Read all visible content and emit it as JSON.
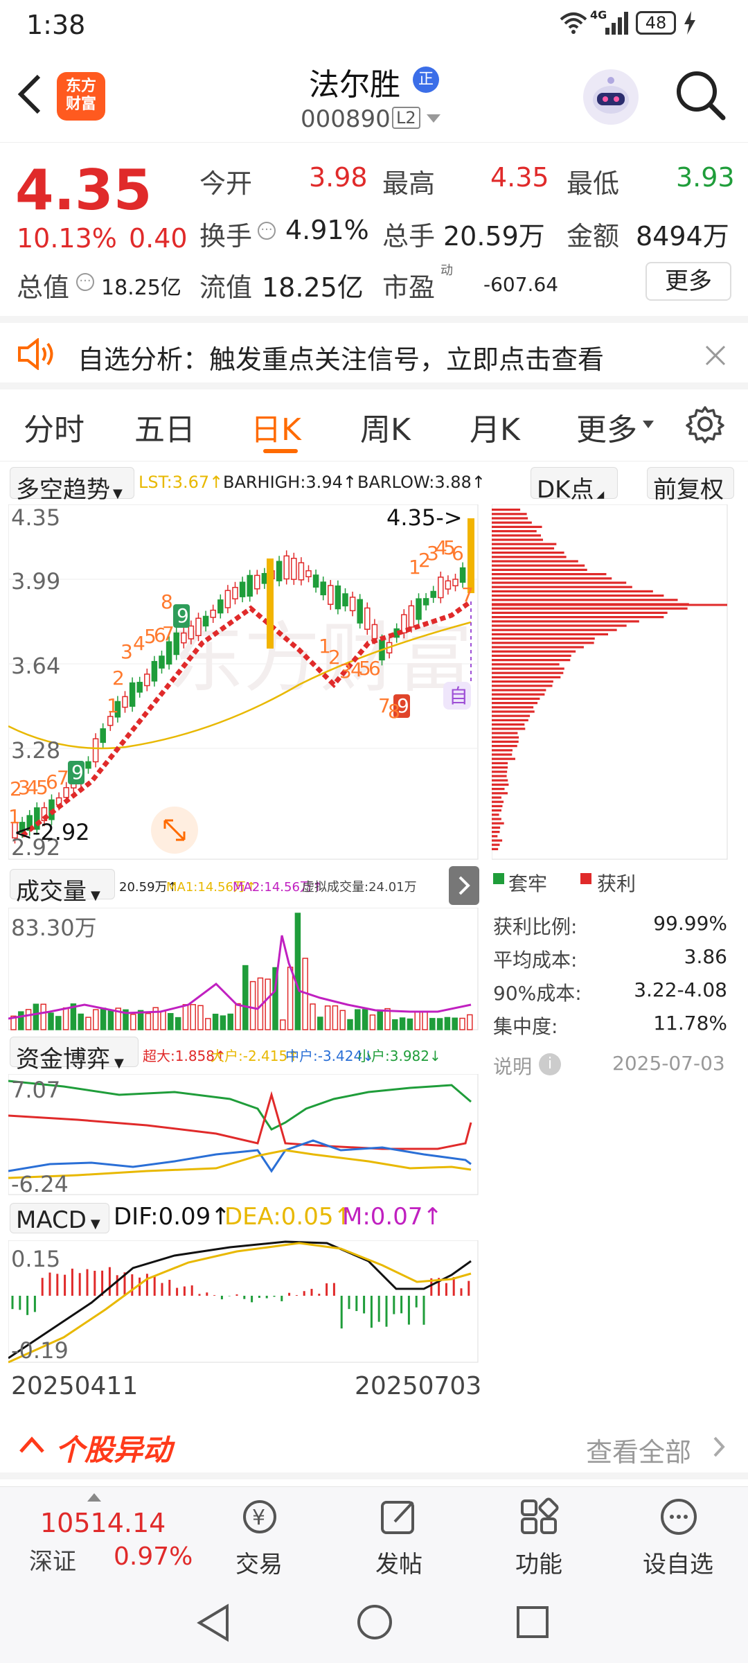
{
  "status": {
    "time": "1:38",
    "network": "4G",
    "battery": "48"
  },
  "header": {
    "logo_line1": "东方",
    "logo_line2": "财富",
    "name": "法尔胜",
    "badge": "正",
    "code": "000890",
    "level": "L2"
  },
  "quote": {
    "price": "4.35",
    "pct": "10.13%",
    "change": "0.40",
    "open_label": "今开",
    "open": "3.98",
    "high_label": "最高",
    "high": "4.35",
    "low_label": "最低",
    "low": "3.93",
    "turnover_label": "换手",
    "turnover": "4.91%",
    "volume_label": "总手",
    "volume": "20.59万",
    "amount_label": "金额",
    "amount": "8494万",
    "mktcap_label": "总值",
    "mktcap": "18.25亿",
    "float_label": "流值",
    "float": "18.25亿",
    "pe_label": "市盈",
    "pe_sup": "动",
    "pe": "-607.64",
    "more": "更多"
  },
  "alert": {
    "text": "自选分析：触发重点关注信号，立即点击查看"
  },
  "tabs": [
    "分时",
    "五日",
    "日K",
    "周K",
    "月K",
    "更多"
  ],
  "active_tab": "日K",
  "kline": {
    "indicator": "多空趋势",
    "lst": "LST:3.67↑",
    "barhigh": "BARHIGH:3.94↑",
    "barlow": "BARLOW:3.88↑",
    "dk": "DK点",
    "adjust": "前复权",
    "y_labels": [
      "4.35",
      "3.99",
      "3.64",
      "3.28",
      "2.92"
    ],
    "max_marker": "4.35->",
    "min_marker": "<-2.92",
    "auto_badge": "自"
  },
  "volume": {
    "label": "成交量",
    "vol": "20.59万↑",
    "ma1": "MA1:14.56万↑",
    "ma2": "MA2:14.56万↑",
    "virtual": "虚拟成交量:24.01万",
    "y_label": "83.30万"
  },
  "fund": {
    "label": "资金博弈",
    "super": "超大:1.858↑",
    "large": "大户:-2.415↑",
    "mid": "中户:-3.424↓",
    "small": "小户:3.982↓",
    "y_top": "7.07",
    "y_bottom": "-6.24"
  },
  "macd": {
    "label": "MACD",
    "dif": "DIF:0.09↑",
    "dea": "DEA:0.05↑",
    "m": "M:0.07↑",
    "y_top": "0.15",
    "y_bottom": "-0.19"
  },
  "dates": {
    "start": "20250411",
    "end": "20250703"
  },
  "chips": {
    "legend_trapped": "套牢",
    "legend_profit": "获利",
    "rows": [
      {
        "label": "获利比例:",
        "value": "99.99%"
      },
      {
        "label": "平均成本:",
        "value": "3.86"
      },
      {
        "label": "90%成本:",
        "value": "3.22-4.08"
      },
      {
        "label": "集中度:",
        "value": "11.78%"
      }
    ],
    "note": "说明",
    "date": "2025-07-03"
  },
  "movement": {
    "title": "个股异动",
    "view_all": "查看全部"
  },
  "footer": {
    "index_value": "10514.14",
    "index_name": "深证",
    "index_pct": "0.97%",
    "items": [
      "交易",
      "发帖",
      "功能",
      "设自选"
    ]
  },
  "colors": {
    "up": "#e02a2a",
    "down": "#1f9d3a",
    "accent": "#ff6a00",
    "ma_yellow": "#e8b800",
    "purple": "#c020c0",
    "blue": "#2a6fd6"
  }
}
